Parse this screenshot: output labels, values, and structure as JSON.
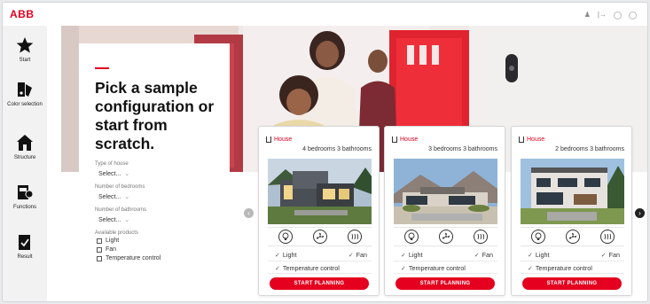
{
  "brand": {
    "logo_text": "ABB",
    "accent_color": "#e4001e"
  },
  "sidebar": {
    "items": [
      {
        "label": "Start",
        "icon": "star-icon"
      },
      {
        "label": "Color selection",
        "icon": "color-palette-icon"
      },
      {
        "label": "Structure",
        "icon": "house-icon"
      },
      {
        "label": "Functions",
        "icon": "functions-icon"
      },
      {
        "label": "Result",
        "icon": "result-clipboard-icon"
      }
    ]
  },
  "topbar": {
    "icons": [
      "user-icon",
      "exit-icon",
      "help-icon",
      "settings-icon"
    ]
  },
  "intro": {
    "headline": "Pick a sample configuration or start from scratch."
  },
  "filters": {
    "house_type": {
      "label": "Type of house",
      "value": "Select..."
    },
    "bedrooms": {
      "label": "Number of bedrooms",
      "value": "Select..."
    },
    "bathrooms": {
      "label": "Number of bathrooms",
      "value": "Select..."
    },
    "products": {
      "label": "Available products",
      "options": [
        "Light",
        "Fan",
        "Temperature control"
      ]
    }
  },
  "cards": [
    {
      "tag": "House",
      "bedrooms": "4",
      "bed_label": "bedrooms",
      "bathrooms": "3",
      "bath_label": "bathrooms",
      "features": [
        "Light",
        "Fan",
        "Temperature control"
      ],
      "button": "START PLANNING"
    },
    {
      "tag": "House",
      "bedrooms": "3",
      "bed_label": "bedrooms",
      "bathrooms": "3",
      "bath_label": "bathrooms",
      "features": [
        "Light",
        "Fan",
        "Temperature control"
      ],
      "button": "START PLANNING"
    },
    {
      "tag": "House",
      "bedrooms": "2",
      "bed_label": "bedrooms",
      "bathrooms": "3",
      "bath_label": "bathrooms",
      "features": [
        "Light",
        "Fan",
        "Temperature control"
      ],
      "button": "START PLANNING"
    }
  ],
  "carousel": {
    "prev_icon": "chevron-left-icon",
    "next_icon": "chevron-right-icon"
  }
}
